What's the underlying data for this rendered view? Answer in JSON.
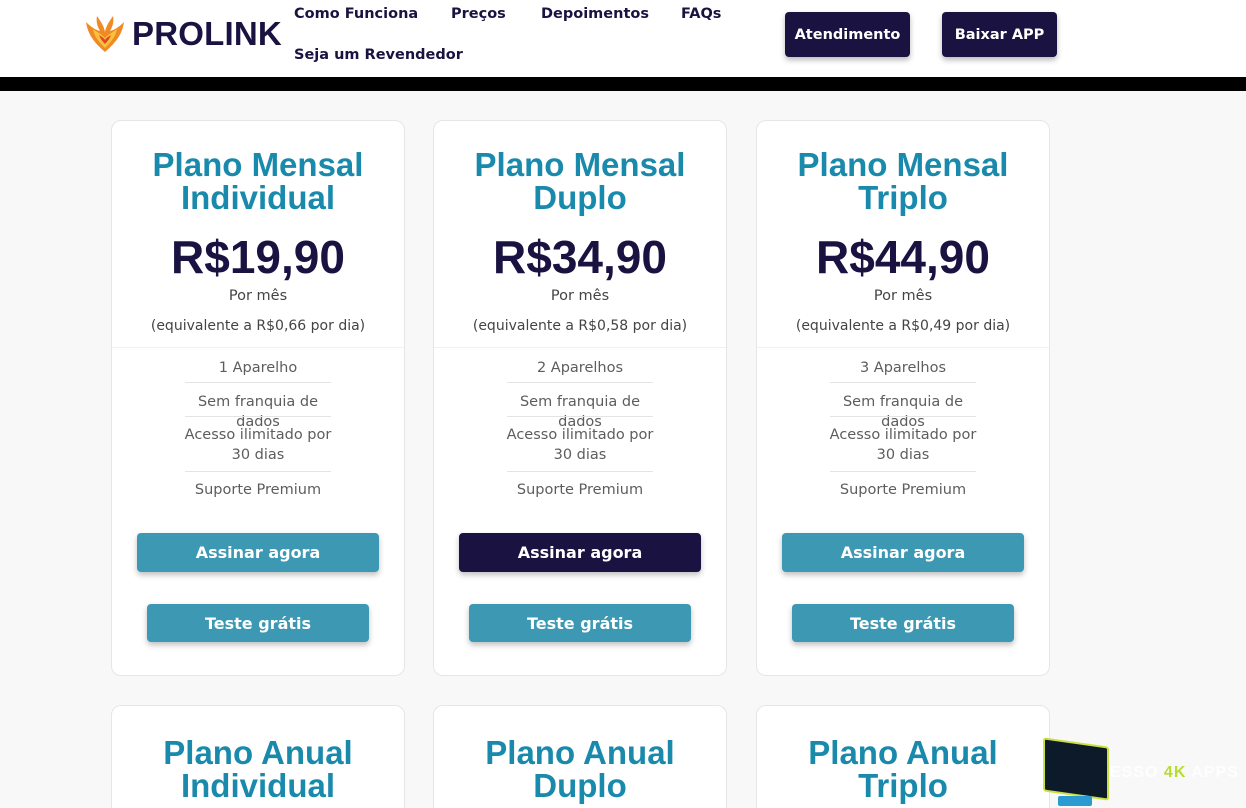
{
  "header": {
    "logo_text": "PROLINK",
    "nav": [
      "Como Funciona",
      "Preços",
      "Depoimentos",
      "FAQs",
      "Seja um Revendedor"
    ],
    "buttons": [
      "Atendimento",
      "Baixar APP"
    ]
  },
  "colors": {
    "brand_dark": "#1a1240",
    "title_teal": "#1a8aac",
    "button_teal": "#3d98b3",
    "button_dark": "#1a1240"
  },
  "plans": [
    {
      "title_line1": "Plano Mensal",
      "title_line2": "Individual",
      "price": "R$19,90",
      "period": "Por mês",
      "equivalent": "(equivalente a R$0,66 por dia)",
      "features": [
        "1 Aparelho",
        "Sem franquia de dados",
        "Acesso ilimitado por 30 dias",
        "Suporte Premium"
      ],
      "subscribe_label": "Assinar agora",
      "trial_label": "Teste grátis",
      "highlighted": false
    },
    {
      "title_line1": "Plano Mensal",
      "title_line2": "Duplo",
      "price": "R$34,90",
      "period": "Por mês",
      "equivalent": "(equivalente a R$0,58 por dia)",
      "features": [
        "2 Aparelhos",
        "Sem franquia de dados",
        "Acesso ilimitado por 30 dias",
        "Suporte Premium"
      ],
      "subscribe_label": "Assinar agora",
      "trial_label": "Teste grátis",
      "highlighted": true
    },
    {
      "title_line1": "Plano Mensal",
      "title_line2": "Triplo",
      "price": "R$44,90",
      "period": "Por mês",
      "equivalent": "(equivalente a R$0,49 por dia)",
      "features": [
        "3 Aparelhos",
        "Sem franquia de dados",
        "Acesso ilimitado por 30 dias",
        "Suporte Premium"
      ],
      "subscribe_label": "Assinar agora",
      "trial_label": "Teste grátis",
      "highlighted": false
    }
  ],
  "annual_plans": [
    {
      "title_line1": "Plano Anual",
      "title_line2": "Individual"
    },
    {
      "title_line1": "Plano Anual",
      "title_line2": "Duplo"
    },
    {
      "title_line1": "Plano Anual",
      "title_line2": "Triplo"
    }
  ],
  "watermark": {
    "text_a": "ESSO",
    "text_b": "4K",
    "text_c": "APPS"
  }
}
